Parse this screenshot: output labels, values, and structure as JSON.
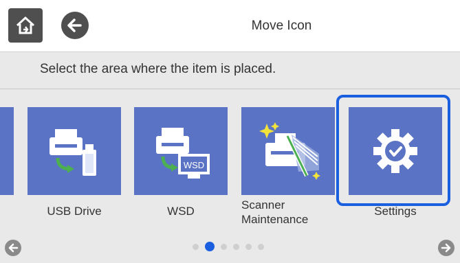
{
  "header": {
    "title": "Move Icon",
    "home_icon": "home-icon",
    "back_icon": "back-arrow-icon"
  },
  "instruction": "Select the area where the item is placed.",
  "tiles": [
    {
      "label": "USB Drive",
      "icon": "usb-drive-icon"
    },
    {
      "label": "WSD",
      "icon": "wsd-icon"
    },
    {
      "label": "Scanner\nMaintenance",
      "icon": "scanner-maintenance-icon"
    },
    {
      "label": "Settings",
      "icon": "settings-gear-icon",
      "selected": true
    }
  ],
  "pagination": {
    "pages": 6,
    "current": 2
  },
  "colors": {
    "tile": "#5a73c4",
    "selection": "#1a5fe0",
    "background": "#e9e9e9"
  }
}
